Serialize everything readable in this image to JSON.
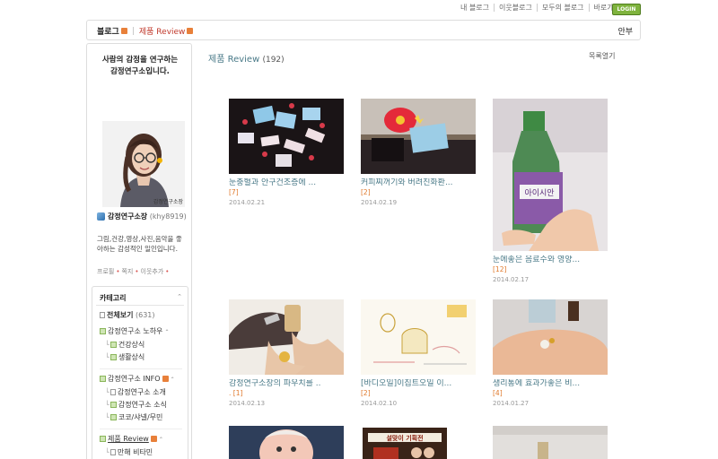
{
  "topnav": {
    "links": [
      "내 블로그",
      "이웃블로그",
      "모두의 블로그",
      "바로가기"
    ],
    "login": "LOGIN"
  },
  "header": {
    "crumb_blog": "블로그",
    "crumb_category": "제품 Review",
    "right": "안부"
  },
  "sidebar": {
    "title_line1": "사람의 감정을 연구하는",
    "title_line2": "감정연구소입니다.",
    "avatar_caption": "감정연구소장",
    "nickname": "감정연구소장",
    "user_id": "(khy8919)",
    "intro": "그림,건강,영상,사진,음악을 좋아하는 감성적인 일인입니다.",
    "links": [
      "프로필",
      "쪽지",
      "이웃추가"
    ]
  },
  "categories": {
    "heading": "카테고리",
    "all_label": "전체보기",
    "all_count": "(631)",
    "groups": [
      {
        "label": "감정연구소 노하우",
        "children": [
          "건강상식",
          "생활상식"
        ]
      },
      {
        "label": "감정연구소 INFO",
        "children": [
          "감정연구소 소개",
          "감정연구소 소식",
          "코코/샤넬/무민"
        ]
      },
      {
        "label": "제품 Review",
        "children": [
          "만해 비타민"
        ]
      }
    ]
  },
  "content": {
    "title": "제품 Review",
    "count": "(192)",
    "list_toggle": "목록열기",
    "posts": [
      {
        "title": "눈충혈과 안구건조증에 ...",
        "comments": "[7]",
        "date": "2014.02.21"
      },
      {
        "title": "커피찌꺼기와 버려진화환...",
        "comments": "[2]",
        "date": "2014.02.19"
      },
      {
        "title": "눈에좋은 음료수와 영양...",
        "comments": "[12]",
        "date": "2014.02.17"
      },
      {
        "title": "감정연구소장의 파우치를 ..",
        "comments": ". [1]",
        "date": "2014.02.13"
      },
      {
        "title": "[바디오일]이집트오일 이...",
        "comments": "[2]",
        "date": "2014.02.10"
      },
      {
        "title": "생리통에 효과가좋은 비...",
        "comments": "[4]",
        "date": "2014.01.27"
      },
      {
        "title": "",
        "comments": "",
        "date": ""
      },
      {
        "title": "",
        "comments": "",
        "date": ""
      },
      {
        "title": "",
        "comments": "",
        "date": ""
      }
    ],
    "bottle_label": "아이시안",
    "poster_label": "설맞이 기획전"
  },
  "colors": {
    "accent": "#4a7a88",
    "orange": "#e0792b",
    "green": "#7fb33e"
  }
}
